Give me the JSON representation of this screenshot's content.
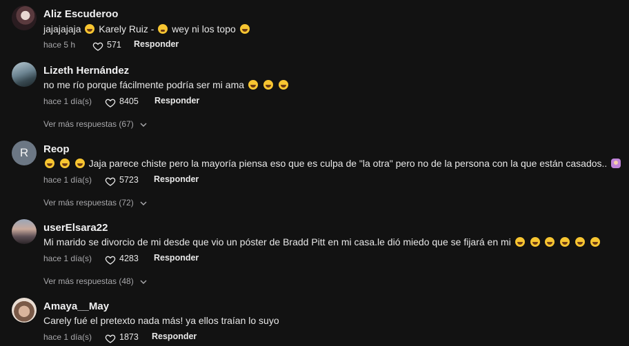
{
  "comments": [
    {
      "username": "Aliz Escuderoo",
      "text_parts": [
        "jajajajaja",
        "Karely Ruiz -",
        "wey ni los topo"
      ],
      "time": "hace 5 h",
      "likes": "571",
      "reply": "Responder"
    },
    {
      "username": "Lizeth Hernández",
      "text": "no me río porque fácilmente podría ser mi ama",
      "time": "hace 1 día(s)",
      "likes": "8405",
      "reply": "Responder",
      "more_replies": "Ver más respuestas (67)"
    },
    {
      "username": "Reop",
      "avatar_letter": "R",
      "text": "Jaja parece chiste pero la mayoría piensa eso que es culpa de \"la otra\" pero no de la persona con la que están casados..",
      "time": "hace 1 día(s)",
      "likes": "5723",
      "reply": "Responder",
      "more_replies": "Ver más respuestas (72)"
    },
    {
      "username": "userElsara22",
      "text": "Mi marido se divorcio de mi desde que vio un póster de Bradd Pitt en mi casa.le dió miedo que se fijará en mi",
      "time": "hace 1 día(s)",
      "likes": "4283",
      "reply": "Responder",
      "more_replies": "Ver más respuestas (48)"
    },
    {
      "username": "Amaya__May",
      "text": "Carely fué el pretexto nada más! ya ellos traían lo suyo",
      "time": "hace 1 día(s)",
      "likes": "1873",
      "reply": "Responder"
    }
  ],
  "icons": {
    "heart": "heart-outline-icon",
    "chevron": "chevron-down-icon",
    "laughing_emoji": "laughing-emoji-icon",
    "sleepy_emoji": "sleepy-emoji-icon",
    "shrug_emoji": "shrug-person-emoji-icon"
  },
  "colors": {
    "background": "#121212",
    "primary_text": "#ffffff",
    "secondary_text": "#a8a8ab"
  }
}
